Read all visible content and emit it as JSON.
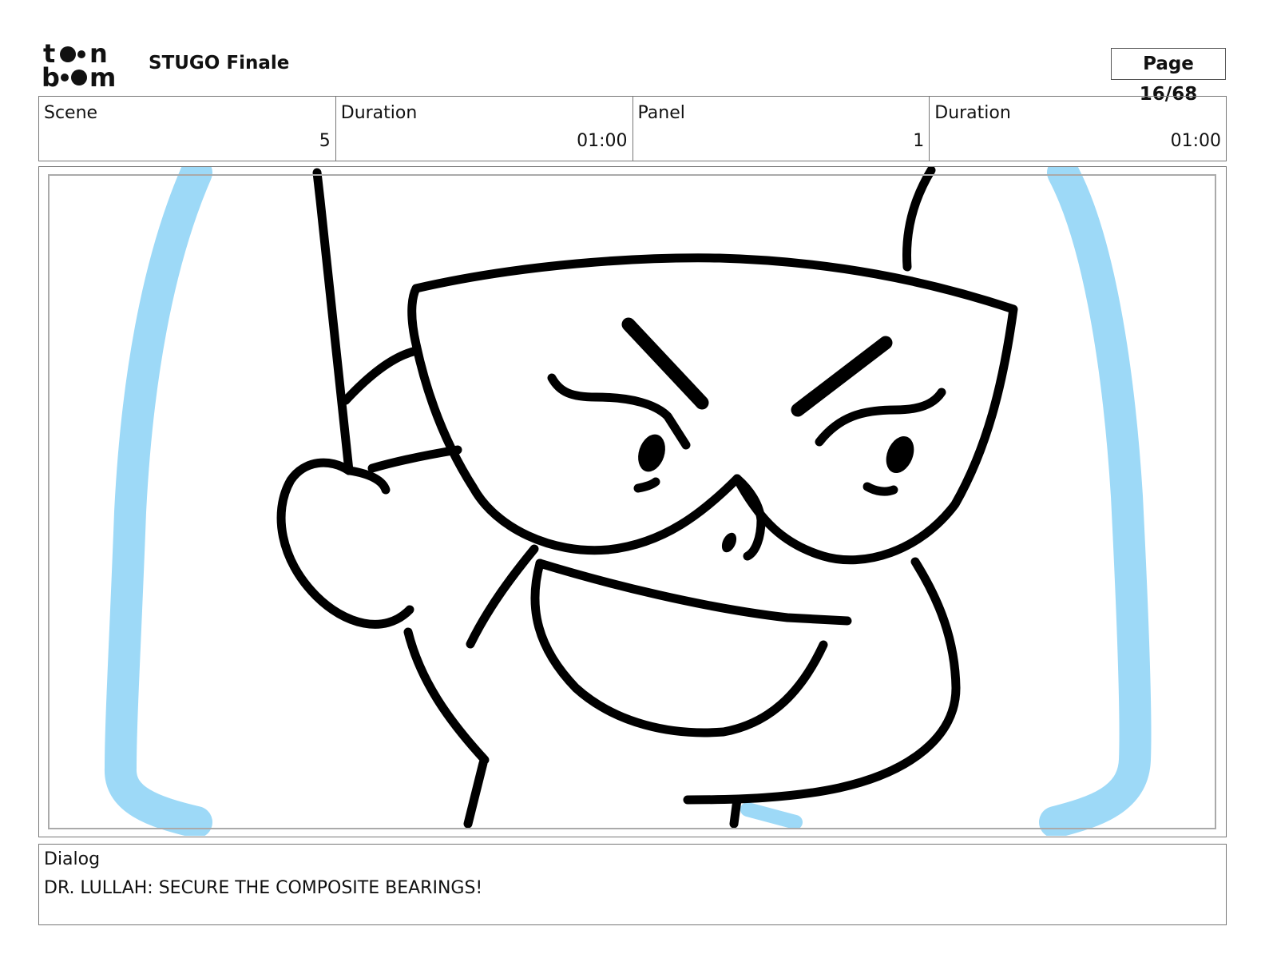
{
  "header": {
    "logo_text": "toon boom",
    "project_title": "STUGO Finale",
    "page_indicator": "Page 16/68"
  },
  "info": {
    "scene_label": "Scene",
    "scene_value": "5",
    "scene_duration_label": "Duration",
    "scene_duration_value": "01:00",
    "panel_label": "Panel",
    "panel_value": "1",
    "panel_duration_label": "Duration",
    "panel_duration_value": "01:00"
  },
  "dialog": {
    "label": "Dialog",
    "text": "DR. LULLAH: SECURE THE COMPOSITE BEARINGS!"
  },
  "colors": {
    "ink": "#000000",
    "blue_guide": "#9dd9f7",
    "border": "#777777"
  }
}
